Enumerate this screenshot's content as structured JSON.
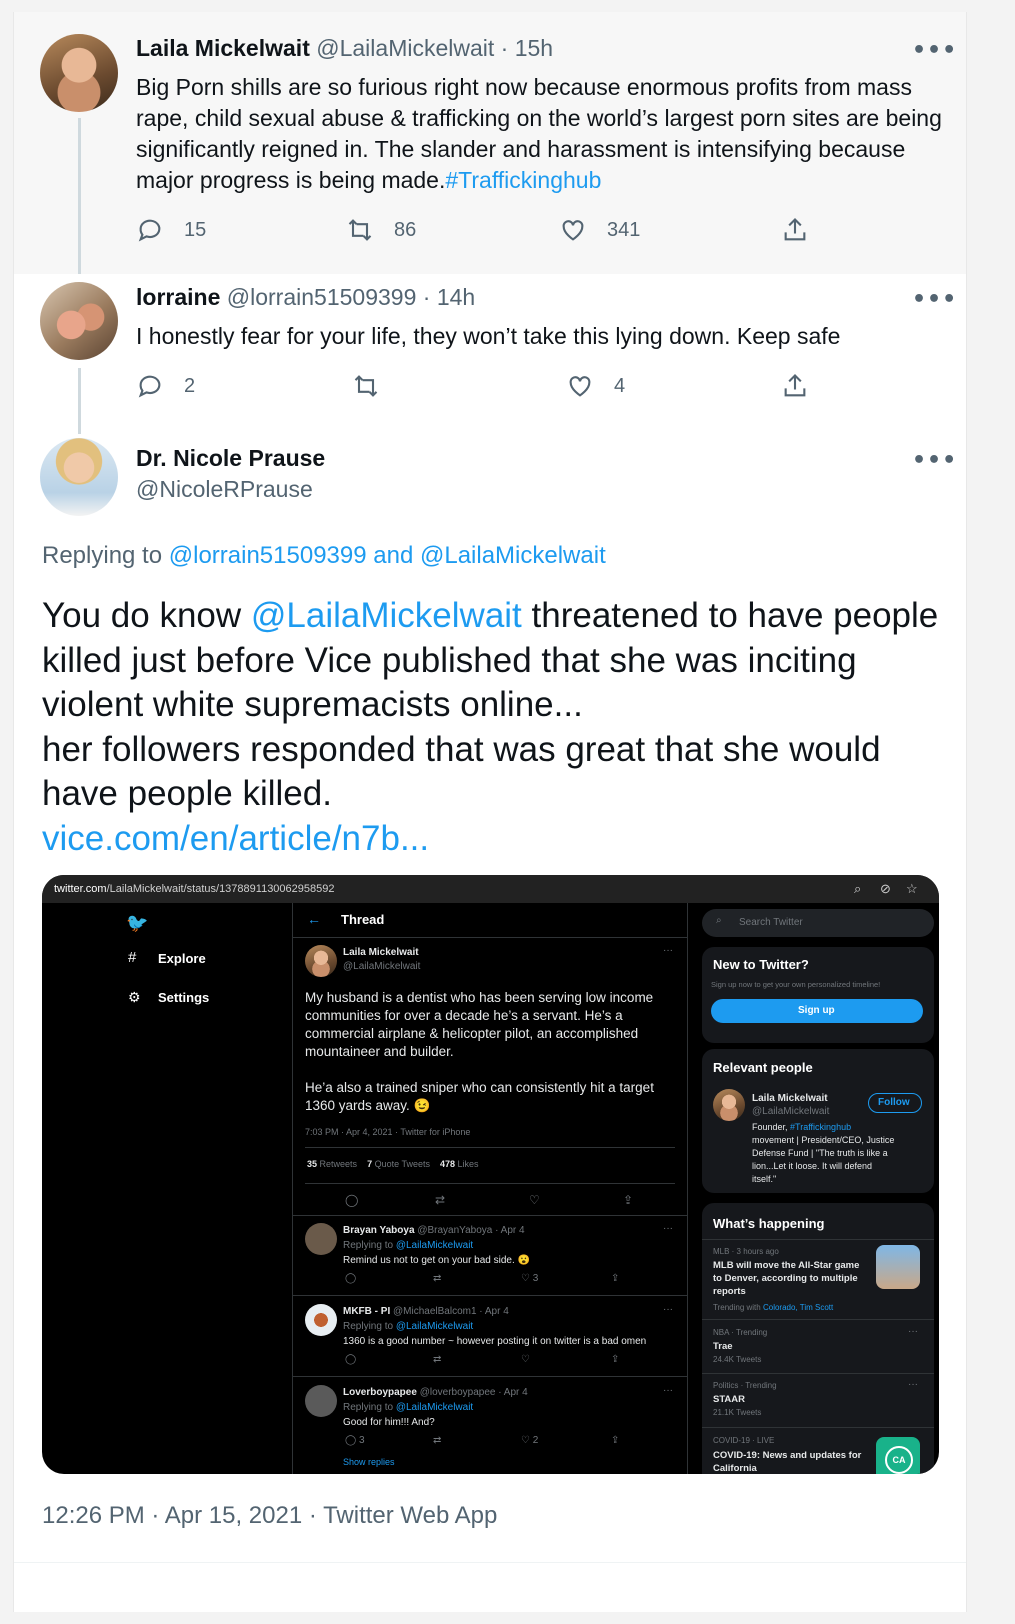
{
  "tweets": [
    {
      "name": "Laila Mickelwait",
      "handle": "@LailaMickelwait",
      "time": "15h",
      "text_main": "Big Porn shills are so furious right now because enormous profits from mass rape, child sexual abuse & trafficking on the world’s largest porn sites are being significantly reigned in. The slander and harassment is intensifying because major progress is being made.",
      "hashtag": "#Traffickinghub",
      "replies": "15",
      "retweets": "86",
      "likes": "341"
    },
    {
      "name": "lorraine",
      "handle": "@lorrain51509399",
      "time": "14h",
      "text": "I honestly fear for your life, they won’t take this lying down. Keep safe",
      "replies": "2",
      "retweets": "",
      "likes": "4"
    }
  ],
  "main_tweet": {
    "name": "Dr. Nicole Prause",
    "handle": "@NicoleRPrause",
    "replying_prefix": "Replying to",
    "replying_user1": "@lorrain51509399",
    "replying_and": "and",
    "replying_user2": "@LailaMickelwait",
    "text_before": "You do know",
    "mention": "@LailaMickelwait",
    "text_after": "threatened to have people killed just before Vice published that she was inciting violent white supremacists online...",
    "text_line2": "her followers responded that was great that she would have people killed.",
    "link": "vice.com/en/article/n7b...",
    "footer": "12:26 PM · Apr 15, 2021 · Twitter Web App"
  },
  "embedded": {
    "url_host": "twitter.com",
    "url_path": "/LailaMickelwait/status/1378891130062958592",
    "nav": [
      "Explore",
      "Settings"
    ],
    "thread_title": "Thread",
    "orig_name": "Laila Mickelwait",
    "orig_handle": "@LailaMickelwait",
    "orig_text1": "My husband is a dentist who has been serving low income communities for over a decade he’s a servant. He’s a commercial airplane & helicopter pilot, an accomplished mountaineer and builder.",
    "orig_text2": "He’a also a trained sniper who can consistently hit a target 1360 yards away. 😉",
    "orig_meta": "7:03 PM · Apr 4, 2021 · Twitter for iPhone",
    "retweets_n": "35",
    "retweets_l": "Retweets",
    "quotes_n": "7",
    "quotes_l": "Quote Tweets",
    "likes_n": "478",
    "likes_l": "Likes",
    "replies": [
      {
        "name": "Brayan Yaboya",
        "meta": "@BrayanYaboya · Apr 4",
        "reply_to": "@LailaMickelwait",
        "text": "Remind us not to get on your bad side. 😮",
        "r": "",
        "l": "3"
      },
      {
        "name": "MKFB - PI",
        "meta": "@MichaelBalcom1 · Apr 4",
        "reply_to": "@LailaMickelwait",
        "text": "1360 is a good number ~ however posting it on twitter is a bad omen",
        "r": "",
        "l": ""
      },
      {
        "name": "Loverboypapee",
        "meta": "@loverboypapee · Apr 4",
        "reply_to": "@LailaMickelwait",
        "text": "Good for him!!! And?",
        "r": "3",
        "l": "2"
      }
    ],
    "replying_to_label": "Replying to",
    "show_replies": "Show replies",
    "search_placeholder": "Search Twitter",
    "new_title": "New to Twitter?",
    "new_sub": "Sign up now to get your own personalized timeline!",
    "signup": "Sign up",
    "relevant_title": "Relevant people",
    "rp_name": "Laila Mickelwait",
    "rp_handle": "@LailaMickelwait",
    "follow": "Follow",
    "rp_bio_1": "Founder,",
    "rp_bio_tag": "#Traffickinghub",
    "rp_bio_2": "movement | President/CEO, Justice",
    "rp_bio_3": "Defense Fund | \"The truth is like a",
    "rp_bio_4": "lion...Let it loose. It will defend",
    "rp_bio_5": "itself.\"",
    "happening_title": "What’s happening",
    "trends": [
      {
        "cat": "MLB · 3 hours ago",
        "title": "MLB will move the All-Star game to Denver, according to multiple reports",
        "trending_with": "Trending with",
        "links": "Colorado, Tim Scott"
      },
      {
        "cat": "NBA · Trending",
        "title": "Trae",
        "count": "24.4K Tweets"
      },
      {
        "cat": "Politics · Trending",
        "title": "STAAR",
        "count": "21.1K Tweets"
      },
      {
        "cat": "COVID-19 · LIVE",
        "title": "COVID-19: News and updates for California"
      }
    ],
    "ca_badge": "CA"
  }
}
